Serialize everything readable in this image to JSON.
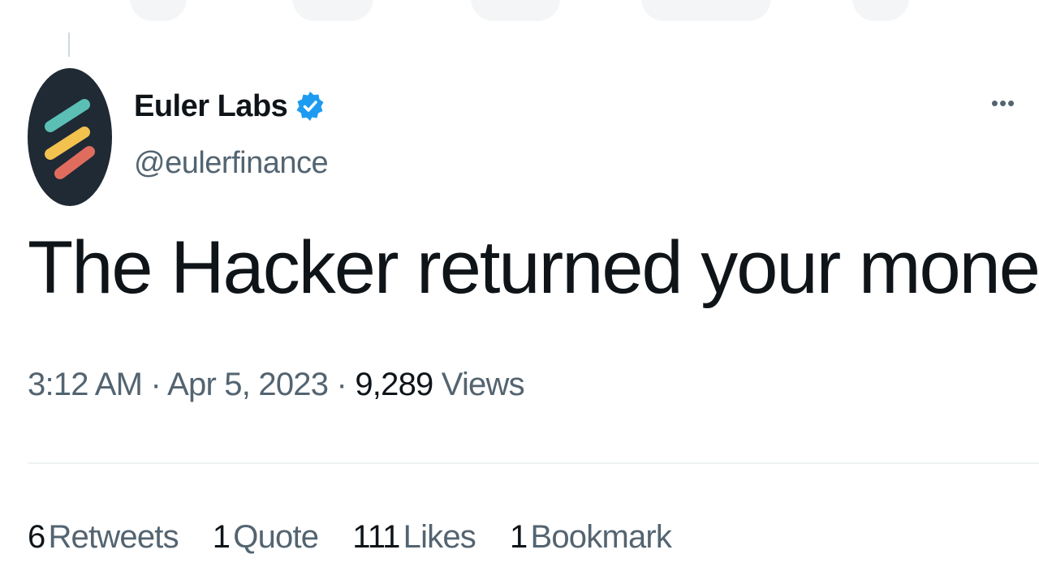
{
  "tweet": {
    "author": {
      "name": "Euler Labs",
      "handle": "@eulerfinance",
      "verified": true,
      "avatar_bg": "#1f2a35",
      "avatar_stripes": [
        "#5bbfb5",
        "#f2c14e",
        "#e06c5e"
      ],
      "verified_color": "#1d9bf0"
    },
    "more_icon": "more-options-icon",
    "text": "The Hacker returned your money...",
    "time": "3:12 AM",
    "separator": "·",
    "date": "Apr 5, 2023",
    "views_count": "9,289",
    "views_label": "Views",
    "stats": [
      {
        "count": "6",
        "label": "Retweets"
      },
      {
        "count": "1",
        "label": "Quote"
      },
      {
        "count": "111",
        "label": "Likes"
      },
      {
        "count": "1",
        "label": "Bookmark"
      }
    ]
  }
}
